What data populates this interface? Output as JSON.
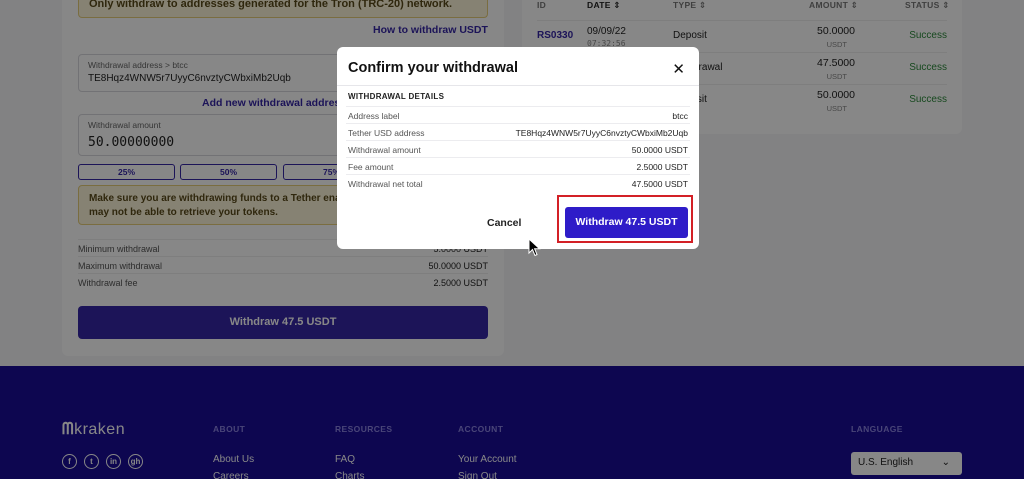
{
  "page": {
    "notice_top": "Only withdraw to addresses generated for the Tron (TRC-20) network.",
    "howto_link": "How to withdraw USDT",
    "address_field_label": "Withdrawal address > btcc",
    "address_field_value": "TE8Hqz4WNW5r7UyyC6nvztyCWbxiMb2Uqb",
    "add_address_link": "Add new withdrawal address",
    "amount_field_label": "Withdrawal amount",
    "amount_field_value": "50.00000000",
    "pct_buttons": [
      "25%",
      "50%",
      "75%"
    ],
    "notice_mid": "Make sure you are withdrawing funds to a Tether enabled address, otherwise you may not be able to retrieve your tokens.",
    "limits": [
      {
        "label": "Minimum withdrawal",
        "value": "5.0000 USDT"
      },
      {
        "label": "Maximum withdrawal",
        "value": "50.0000 USDT"
      },
      {
        "label": "Withdrawal fee",
        "value": "2.5000 USDT"
      }
    ],
    "withdraw_button": "Withdraw 47.5 USDT"
  },
  "history": {
    "headers": {
      "id": "ID",
      "date": "DATE ⇕",
      "type": "TYPE ⇕",
      "amount": "AMOUNT ⇕",
      "status": "STATUS ⇕"
    },
    "rows": [
      {
        "id": "RS0330",
        "date": "09/09/22",
        "time": "07:32:56",
        "type": "Deposit",
        "amount": "50.0000",
        "unit": "USDT",
        "status": "Success"
      },
      {
        "id": "",
        "date": "",
        "time": "",
        "type": "Withdrawal",
        "amount": "47.5000",
        "unit": "USDT",
        "status": "Success"
      },
      {
        "id": "",
        "date": "",
        "time": "",
        "type": "Deposit",
        "amount": "50.0000",
        "unit": "USDT",
        "status": "Success"
      }
    ]
  },
  "footer": {
    "logo": "kraken",
    "social": [
      "f",
      "t",
      "in",
      "gh"
    ],
    "about_head": "ABOUT",
    "about_links": [
      "About Us",
      "Careers"
    ],
    "resources_head": "RESOURCES",
    "resources_links": [
      "FAQ",
      "Charts"
    ],
    "account_head": "ACCOUNT",
    "account_links": [
      "Your Account",
      "Sign Out"
    ],
    "language_head": "LANGUAGE",
    "language_value": "U.S. English"
  },
  "modal": {
    "title": "Confirm your withdrawal",
    "close": "✕",
    "details_head": "WITHDRAWAL DETAILS",
    "rows": [
      {
        "label": "Address label",
        "value": "btcc"
      },
      {
        "label": "Tether USD address",
        "value": "TE8Hqz4WNW5r7UyyC6nvztyCWbxiMb2Uqb"
      },
      {
        "label": "Withdrawal amount",
        "value": "50.0000 USDT"
      },
      {
        "label": "Fee amount",
        "value": "2.5000 USDT"
      },
      {
        "label": "Withdrawal net total",
        "value": "47.5000 USDT"
      }
    ],
    "cancel": "Cancel",
    "confirm": "Withdraw 47.5 USDT"
  }
}
